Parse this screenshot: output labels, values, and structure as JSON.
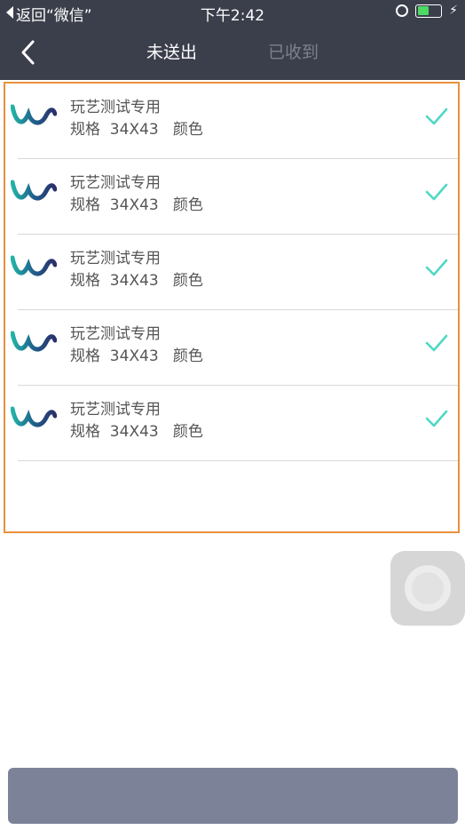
{
  "status_bar": {
    "back_app": "返回“微信”",
    "time": "下午2:42"
  },
  "nav": {
    "tab_unsent": "未送出",
    "tab_received": "已收到"
  },
  "items": [
    {
      "title": "玩艺测试专用",
      "spec": "规格  34X43   颜色"
    },
    {
      "title": "玩艺测试专用",
      "spec": "规格  34X43   颜色"
    },
    {
      "title": "玩艺测试专用",
      "spec": "规格  34X43   颜色"
    },
    {
      "title": "玩艺测试专用",
      "spec": "规格  34X43   颜色"
    },
    {
      "title": "玩艺测试专用",
      "spec": "规格  34X43   颜色"
    }
  ],
  "colors": {
    "header_bg": "#3b3f4b",
    "check": "#4fd8c4",
    "frame": "#e8913c",
    "bottom_bar": "#7c8399"
  },
  "icons": [
    "back-chevron-icon",
    "alarm-icon",
    "battery-icon",
    "charging-bolt-icon",
    "brand-logo-icon",
    "check-icon"
  ]
}
